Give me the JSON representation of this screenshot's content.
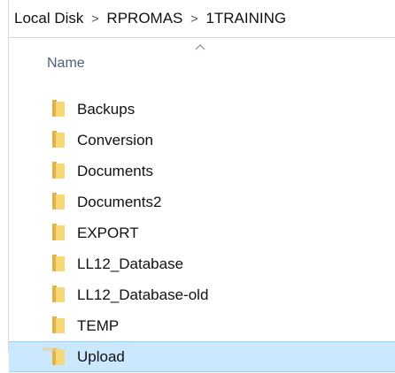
{
  "breadcrumb": {
    "items": [
      "Local Disk",
      "RPROMAS",
      "1TRAINING"
    ],
    "separator": ">"
  },
  "header": {
    "name_label": "Name",
    "sort_indicator": "chevron-up-icon"
  },
  "files": [
    {
      "name": "Backups",
      "icon": "folder-icon",
      "selected": false
    },
    {
      "name": "Conversion",
      "icon": "folder-icon",
      "selected": false
    },
    {
      "name": "Documents",
      "icon": "folder-icon",
      "selected": false
    },
    {
      "name": "Documents2",
      "icon": "folder-icon",
      "selected": false
    },
    {
      "name": "EXPORT",
      "icon": "folder-icon",
      "selected": false
    },
    {
      "name": "LL12_Database",
      "icon": "folder-icon",
      "selected": false
    },
    {
      "name": "LL12_Database-old",
      "icon": "folder-icon",
      "selected": false
    },
    {
      "name": "TEMP",
      "icon": "folder-icon",
      "selected": false
    },
    {
      "name": "Upload",
      "icon": "folder-icon",
      "selected": true
    }
  ],
  "colors": {
    "selection_bg": "#cce8ff",
    "selection_border": "#99d1ff",
    "folder_yellow": "#f8d775",
    "folder_dark": "#e0b34a",
    "header_text": "#4c607a"
  }
}
